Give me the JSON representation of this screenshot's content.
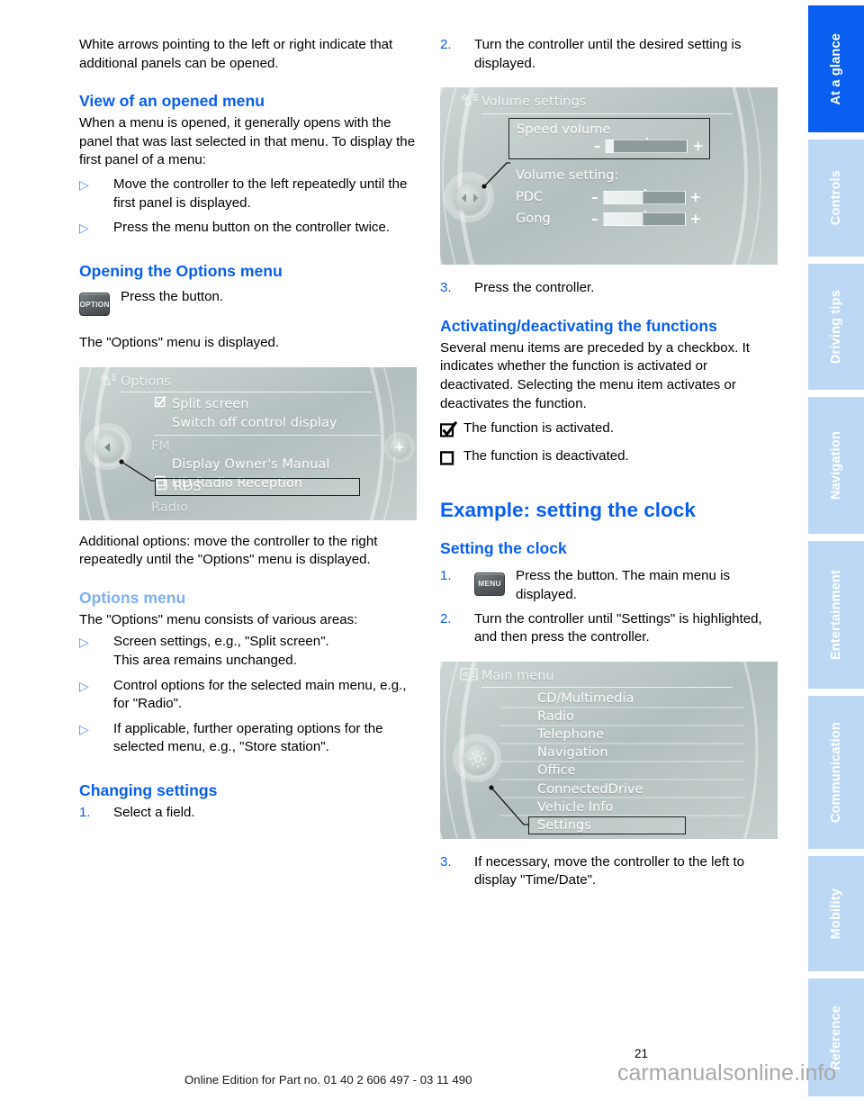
{
  "document": {
    "page_number": "21",
    "footer": "Online Edition for Part no. 01 40 2 606 497 - 03 11 490",
    "watermark": "carmanualsonline.info"
  },
  "sidebar": {
    "tabs": [
      {
        "label": "At a glance",
        "active": true
      },
      {
        "label": "Controls",
        "active": false
      },
      {
        "label": "Driving tips",
        "active": false
      },
      {
        "label": "Navigation",
        "active": false
      },
      {
        "label": "Entertainment",
        "active": false
      },
      {
        "label": "Communication",
        "active": false
      },
      {
        "label": "Mobility",
        "active": false
      },
      {
        "label": "Reference",
        "active": false
      }
    ],
    "active_color": "#0a5ff0",
    "inactive_color": "#bcd8f5"
  },
  "left_column": {
    "intro": "White arrows pointing to the left or right indicate that additional panels can be opened.",
    "heading_view": "View of an opened menu",
    "view_body": "When a menu is opened, it generally opens with the panel that was last selected in that menu. To display the first panel of a menu:",
    "view_bullets": [
      "Move the controller to the left repeatedly until the first panel is displayed.",
      "Press the menu button on the controller twice."
    ],
    "heading_options": "Opening the Options menu",
    "option_button_label": "OPTION",
    "option_button_text": "Press the button.",
    "options_displayed": "The \"Options\" menu is displayed.",
    "after_screen": "Additional options: move the controller to the right repeatedly until the \"Options\" menu is displayed.",
    "heading_options_menu": "Options menu",
    "options_menu_body": "The \"Options\" menu consists of various areas:",
    "options_bullets": [
      {
        "text": "Screen settings, e.g., \"Split screen\".",
        "sub": "This area remains unchanged."
      },
      {
        "text": "Control options for the selected main menu, e.g., for \"Radio\".",
        "sub": ""
      },
      {
        "text": "If applicable, further operating options for the selected menu, e.g., \"Store station\".",
        "sub": ""
      }
    ],
    "heading_changing": "Changing settings",
    "changing_step1_num": "1.",
    "changing_step1": "Select a field."
  },
  "right_column": {
    "step2_num": "2.",
    "step2": "Turn the controller until the desired setting is displayed.",
    "step3_num": "3.",
    "step3": "Press the controller.",
    "heading_activating": "Activating/deactivating the functions",
    "activating_body": "Several menu items are preceded by a checkbox. It indicates whether the function is activated or deactivated. Selecting the menu item activates or deactivates the function.",
    "checkbox_on_text": "The function is activated.",
    "checkbox_off_text": "The function is deactivated.",
    "heading_example": "Example: setting the clock",
    "heading_setting": "Setting the clock",
    "step1_num": "1.",
    "menu_button_label": "MENU",
    "step1": "Press the button. The main menu is displayed.",
    "clock_step2_num": "2.",
    "clock_step2": "Turn the controller until \"Settings\" is highlighted, and then press the controller.",
    "clock_step3_num": "3.",
    "clock_step3": "If necessary, move the controller to the left to display \"Time/Date\"."
  },
  "screens": {
    "options": {
      "title": "Options",
      "header_icon": "radio-signal-icon",
      "items": [
        {
          "label": "Split screen",
          "checkbox": "checked",
          "indent": 1,
          "dim": false,
          "selected": false
        },
        {
          "label": "Switch off control display",
          "checkbox": "none",
          "indent": 2,
          "dim": false,
          "selected": false
        },
        {
          "label": "FM",
          "checkbox": "none",
          "indent": 0,
          "dim": true,
          "selected": false
        },
        {
          "label": "Display Owner's Manual",
          "checkbox": "none",
          "indent": 2,
          "dim": false,
          "selected": false
        },
        {
          "label": "HD Radio Reception",
          "checkbox": "unchecked",
          "indent": 1,
          "dim": false,
          "selected": false
        },
        {
          "label": "RDS",
          "checkbox": "unchecked",
          "indent": 1,
          "dim": false,
          "selected": true
        },
        {
          "label": "Radio",
          "checkbox": "none",
          "indent": 0,
          "dim": true,
          "selected": false
        }
      ],
      "left_arrow": "◀",
      "right_plus": "+"
    },
    "volume": {
      "title": "Volume settings",
      "header_icon": "speaker-settings-icon",
      "selected_label": "Speed volume",
      "selected_slider": {
        "minus": "–",
        "plus": "+",
        "fill_percent": 10
      },
      "group_label": "Volume setting:",
      "rows": [
        {
          "label": "PDC",
          "minus": "–",
          "plus": "+",
          "fill_percent": 50
        },
        {
          "label": "Gong",
          "minus": "–",
          "plus": "+",
          "fill_percent": 50
        }
      ]
    },
    "main_menu": {
      "title": "Main menu",
      "header_icon": "list-menu-icon",
      "items": [
        {
          "label": "CD/Multimedia",
          "selected": false
        },
        {
          "label": "Radio",
          "selected": false
        },
        {
          "label": "Telephone",
          "selected": false
        },
        {
          "label": "Navigation",
          "selected": false
        },
        {
          "label": "Office",
          "selected": false
        },
        {
          "label": "ConnectedDrive",
          "selected": false
        },
        {
          "label": "Vehicle Info",
          "selected": false
        },
        {
          "label": "Settings",
          "selected": true
        }
      ],
      "knob_icon": "gear-icon"
    }
  }
}
